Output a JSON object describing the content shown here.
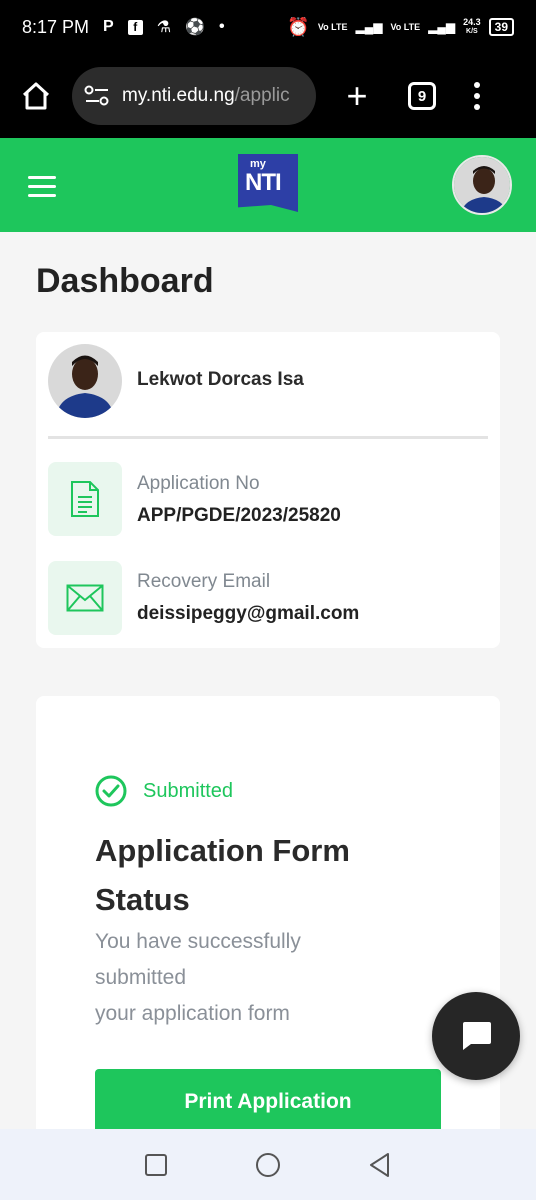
{
  "status_bar": {
    "time": "8:17 PM",
    "net_speed": "24.3",
    "net_unit": "K/S",
    "battery": "39",
    "signal_1": "Vo LTE",
    "signal_2": "LTE",
    "signal_3": "Vo LTE",
    "signal_4": "LTE"
  },
  "browser": {
    "url_domain": "my.nti.edu.ng",
    "url_path": "/applic",
    "tab_count": "9"
  },
  "header": {
    "logo_small": "my",
    "logo_main": "NTI"
  },
  "page": {
    "title": "Dashboard"
  },
  "profile": {
    "name": "Lekwot Dorcas Isa",
    "application_label": "Application No",
    "application_value": "APP/PGDE/2023/25820",
    "email_label": "Recovery Email",
    "email_value": "deissipeggy@gmail.com"
  },
  "status_card": {
    "status": "Submitted",
    "title": "Application Form Status",
    "desc_line1": "You have successfully",
    "desc_line2": "submitted",
    "desc_line3": "your application form",
    "print_button": "Print Application"
  },
  "colors": {
    "brand_green": "#1ec65c",
    "logo_blue": "#2d3fa6"
  }
}
